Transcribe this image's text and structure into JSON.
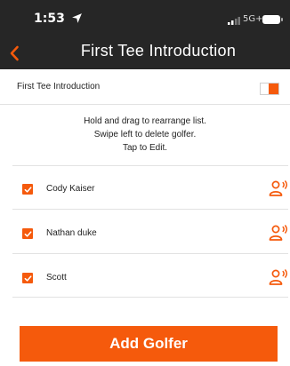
{
  "status_bar": {
    "time": "1:53",
    "network": "5G+"
  },
  "header": {
    "title": "First Tee Introduction"
  },
  "toggle": {
    "label": "First Tee Introduction",
    "enabled": true
  },
  "instructions": [
    "Hold and drag to rearrange list.",
    "Swipe left to delete golfer.",
    "Tap to Edit."
  ],
  "golfers": [
    {
      "name": "Cody Kaiser",
      "checked": true
    },
    {
      "name": "Nathan duke",
      "checked": true
    },
    {
      "name": "Scott",
      "checked": true
    }
  ],
  "add_button": {
    "label": "Add Golfer"
  },
  "colors": {
    "accent": "#f55a0c",
    "header_bg": "#262626",
    "divider": "#e2e2e2"
  },
  "icons": [
    "location-arrow-icon",
    "signal-icon",
    "battery-icon",
    "chevron-left-icon",
    "checkbox-checked-icon",
    "person-voice-icon"
  ]
}
